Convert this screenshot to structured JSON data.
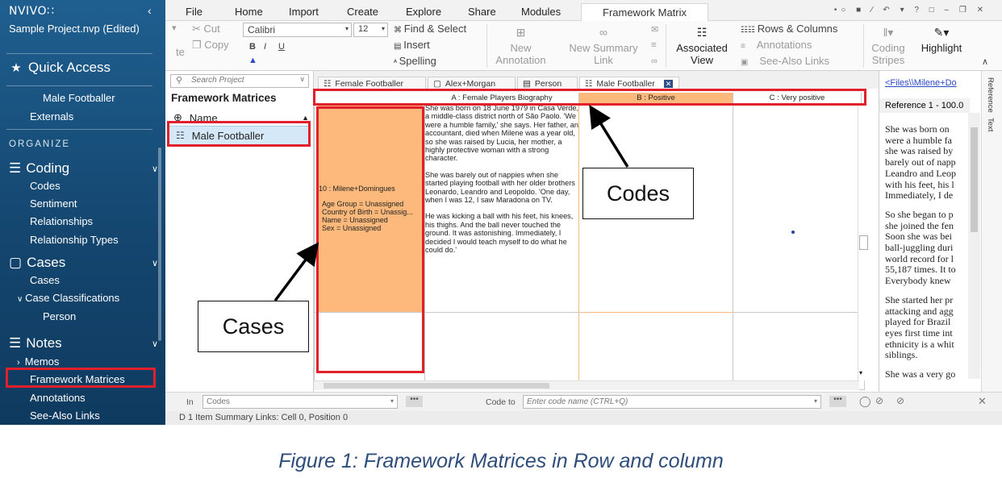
{
  "sidebar": {
    "logo": "NVIVO∷",
    "collapse": "‹",
    "project": "Sample Project.nvp (Edited)",
    "quick_access": "Quick Access",
    "quick_items": [
      "Male Footballer",
      "Externals"
    ],
    "organize": "ORGANIZE",
    "coding": {
      "label": "Coding",
      "items": [
        "Codes",
        "Sentiment",
        "Relationships",
        "Relationship Types"
      ]
    },
    "cases": {
      "label": "Cases",
      "items": [
        "Cases"
      ],
      "classifications": "Case Classifications",
      "sub": "Person"
    },
    "notes": {
      "label": "Notes",
      "items": [
        "Memos",
        "Framework Matrices",
        "Annotations",
        "See-Also Links"
      ]
    }
  },
  "ribbon_tabs": [
    "File",
    "Home",
    "Import",
    "Create",
    "Explore",
    "Share",
    "Modules",
    "Framework Matrix"
  ],
  "ribbon": {
    "cut": "Cut",
    "copy": "Copy",
    "paste_hint": "te",
    "font": "Calibri",
    "size": "12",
    "find_select": "Find & Select",
    "insert": "Insert",
    "spelling": "Spelling",
    "new_annotation": [
      "New",
      "Annotation"
    ],
    "new_summary_link": [
      "New Summary",
      "Link"
    ],
    "associated_view": [
      "Associated",
      "View"
    ],
    "rows_columns": "Rows & Columns",
    "annotations": "Annotations",
    "see_also": "See-Also Links",
    "coding_stripes": [
      "Coding",
      "Stripes"
    ],
    "highlight": "Highlight"
  },
  "nav": {
    "search_placeholder": "Search Project",
    "title": "Framework Matrices",
    "col_header": "Name",
    "row": "Male Footballer"
  },
  "doc_tabs": [
    "Female Footballer",
    "Alex+Morgan",
    "Person",
    "Male Footballer"
  ],
  "matrix": {
    "columns": [
      "A : Female Players Biography",
      "B : Positive",
      "C : Very positive"
    ],
    "row_case": "10 : Milene+Domingues",
    "row_attrs": [
      "Age Group = Unassigned",
      "Country of Birth = Unassig...",
      "Name = Unassigned",
      "Sex = Unassigned"
    ],
    "cell_paragraphs": [
      "She was born on 18 June 1979 in Casa Verde, a middle-class district north of São Paolo. 'We were a humble family,' she says. Her father, an accountant, died when Milene was a year old, so she was raised by Lucia, her mother, a highly protective woman with a strong character.",
      "She was barely out of nappies when she started playing football with her older brothers Leonardo, Leandro and Leopoldo. 'One day, when I was 12, I saw Maradona on TV.",
      "He was kicking a ball with his feet, his knees, his thighs. And the ball never touched the ground. It was astonishing. Immediately, I decided I would teach myself to do what he could do.'"
    ]
  },
  "ref_panel": {
    "link": "<Files\\\\Milene+Do",
    "header": "Reference 1 - 100.0",
    "paragraphs": [
      [
        "She was born on",
        "were a humble fa",
        "she was raised by",
        "barely out of napp",
        "Leandro and Leop",
        "with his feet, his l",
        "Immediately, I de"
      ],
      [
        "So she began to p",
        "she joined the fen",
        "Soon she was bei",
        "ball-juggling duri",
        "world record for l",
        "55,187 times. It to",
        "Everybody knew"
      ],
      [
        "She started her pr",
        "attacking and agg",
        "played for Brazil",
        "eyes first time int",
        "ethnicity is a whit",
        "siblings."
      ],
      [
        "She was a very go"
      ]
    ],
    "side_tabs": [
      "Reference",
      "Text"
    ]
  },
  "findbar": {
    "in": "In",
    "in_value": "Codes",
    "code_to": "Code to",
    "code_placeholder": "Enter code name (CTRL+Q)",
    "dots": "•••"
  },
  "status": "D     1 Item     Summary Links: Cell 0, Position 0",
  "annotations": {
    "cases": "Cases",
    "codes": "Codes"
  },
  "caption": "Figure 1: Framework Matrices in Row and column"
}
